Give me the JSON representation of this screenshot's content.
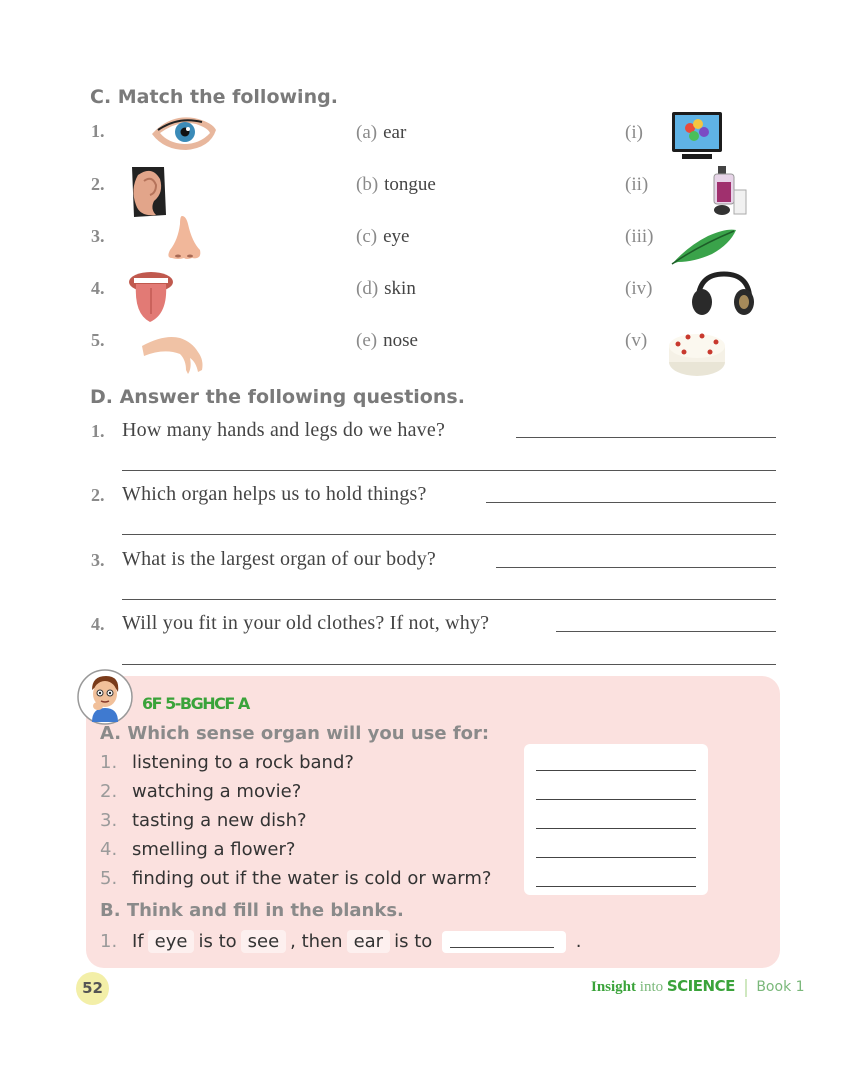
{
  "section_c": {
    "heading": "C. Match the following.",
    "rows": [
      {
        "num": "1.",
        "image": "eye-image",
        "letter": "(a)",
        "word": "ear",
        "roman": "(i)",
        "match_image": "tv-image"
      },
      {
        "num": "2.",
        "image": "ear-image",
        "letter": "(b)",
        "word": "tongue",
        "roman": "(ii)",
        "match_image": "perfume-image"
      },
      {
        "num": "3.",
        "image": "nose-image",
        "letter": "(c)",
        "word": "eye",
        "roman": "(iii)",
        "match_image": "feather-image"
      },
      {
        "num": "4.",
        "image": "tongue-image",
        "letter": "(d)",
        "word": "skin",
        "roman": "(iv)",
        "match_image": "headphones-image"
      },
      {
        "num": "5.",
        "image": "hand-image",
        "letter": "(e)",
        "word": "nose",
        "roman": "(v)",
        "match_image": "cake-image"
      }
    ]
  },
  "section_d": {
    "heading": "D. Answer the following questions.",
    "questions": [
      {
        "num": "1.",
        "text": "How many hands and legs do we have?"
      },
      {
        "num": "2.",
        "text": "Which organ helps us to hold things?"
      },
      {
        "num": "3.",
        "text": "What is the largest organ of our body?"
      },
      {
        "num": "4.",
        "text": "Will you fit in your old clothes? If not, why?"
      }
    ]
  },
  "think_box": {
    "badge": "6F 5-BGHCF A",
    "a_heading": "A.  Which sense organ will you use for:",
    "a_items": [
      {
        "num": "1.",
        "text": "listening to a rock band?"
      },
      {
        "num": "2.",
        "text": "watching a movie?"
      },
      {
        "num": "3.",
        "text": "tasting a new dish?"
      },
      {
        "num": "4.",
        "text": "smelling a flower?"
      },
      {
        "num": "5.",
        "text": "finding out if the water is cold or warm?"
      }
    ],
    "b_heading": "B.  Think and fill in the blanks.",
    "b_item": {
      "num": "1.",
      "w1": "If",
      "c1": "eye",
      "w2": "is to",
      "c2": "see",
      "w3": ", then",
      "c3": "ear",
      "w4": "is to",
      "end": "."
    }
  },
  "footer": {
    "page_number": "52",
    "brand_insight": "Insight",
    "brand_into": "into",
    "brand_science": "SCIENCE",
    "book": "Book 1"
  },
  "colors": {
    "pink_bg": "#fbe1df",
    "green": "#3aa33a",
    "page_badge": "#f3efa8"
  }
}
